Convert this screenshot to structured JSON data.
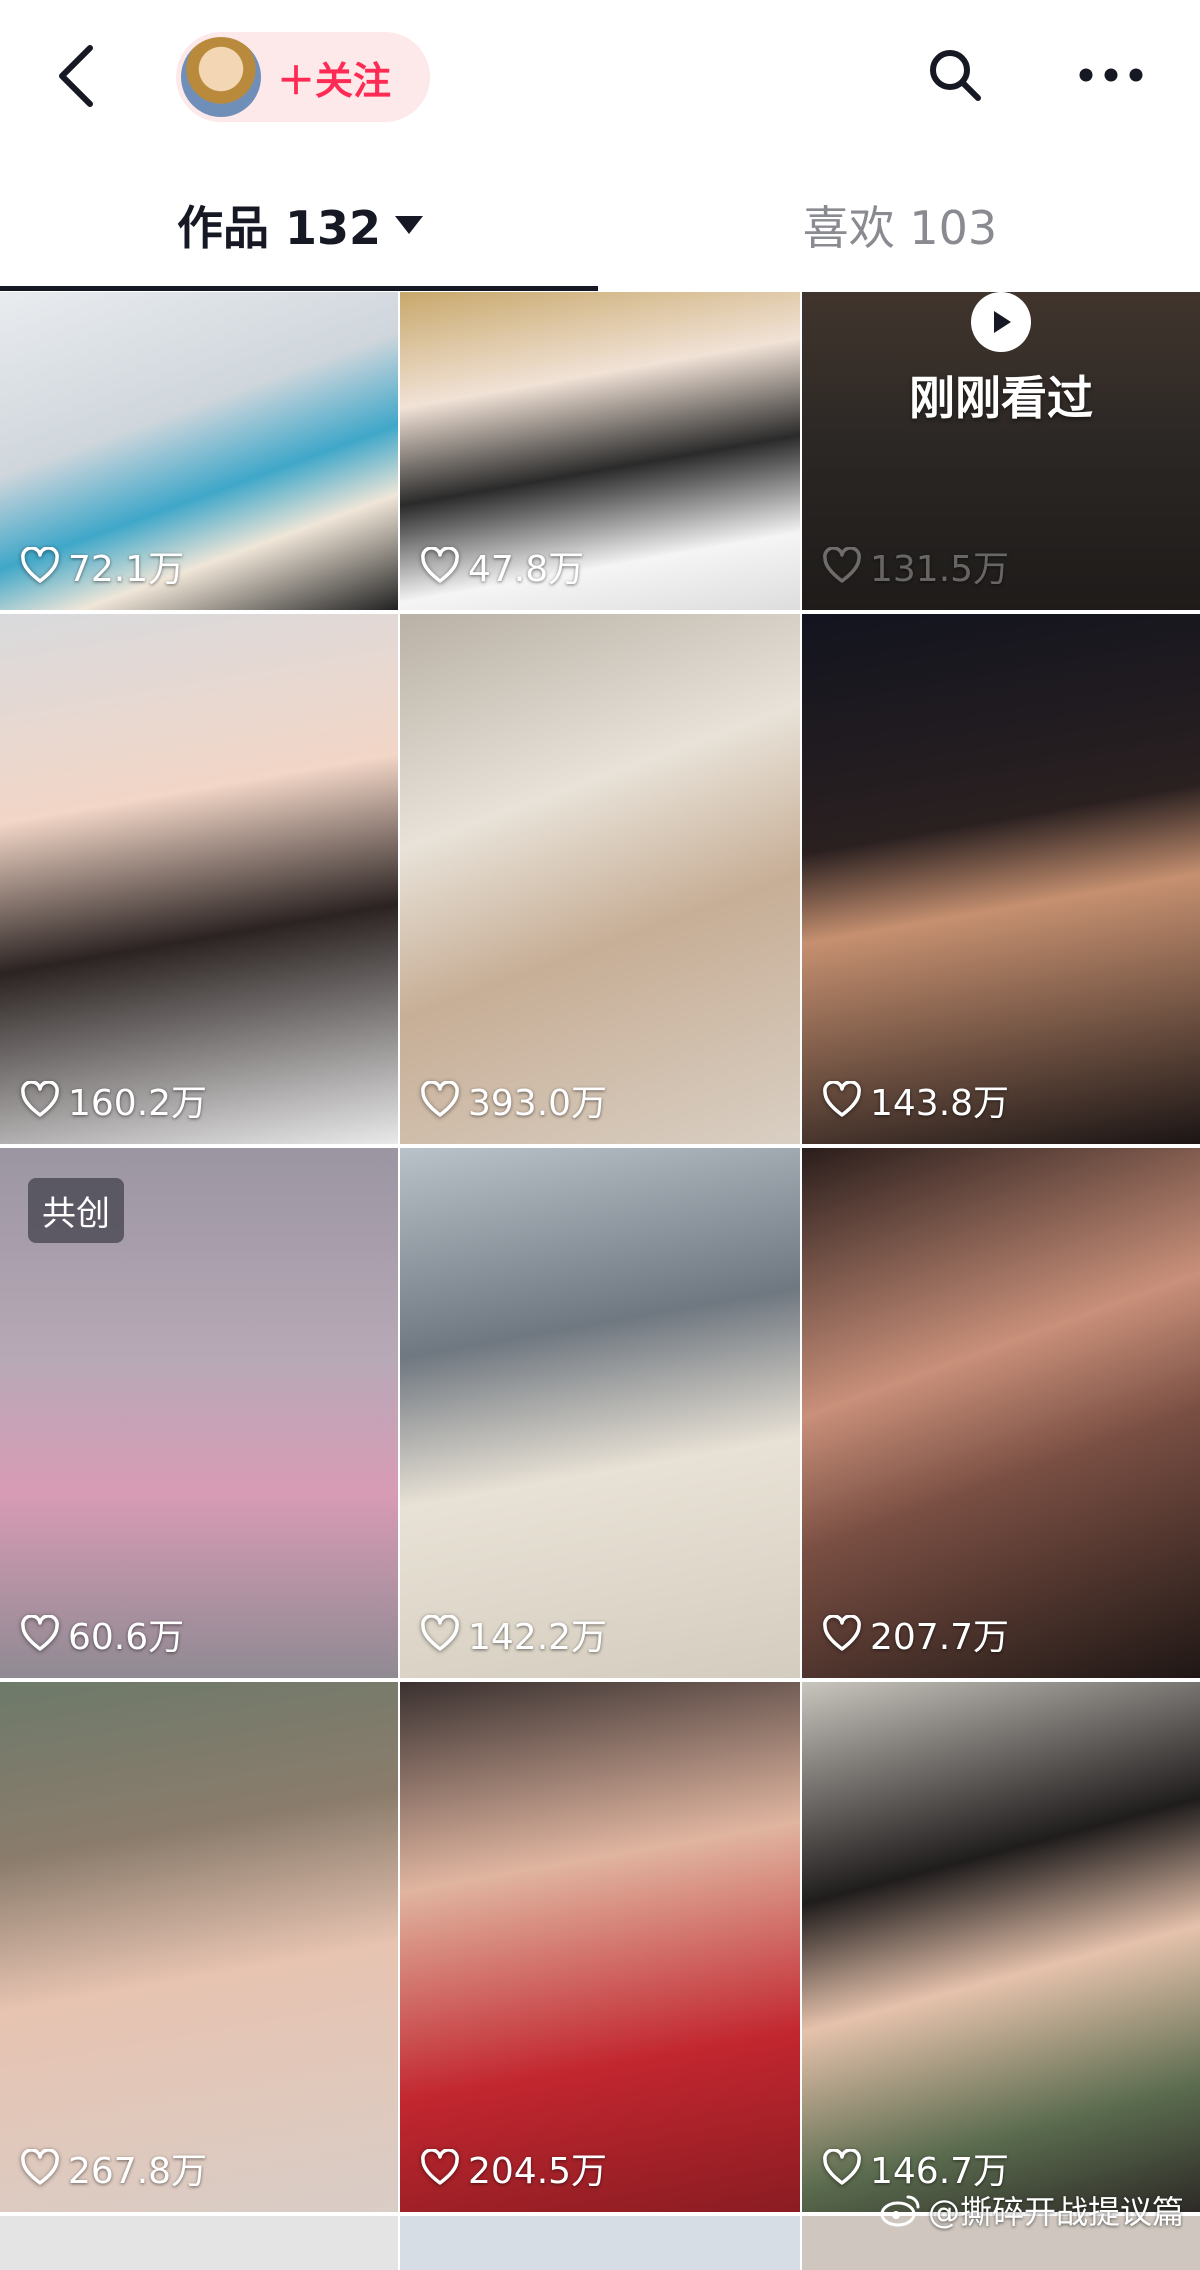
{
  "header": {
    "follow_label": "＋关注",
    "icons": [
      "back-arrow-icon",
      "search-icon",
      "more-icon"
    ]
  },
  "tabs": {
    "works_label": "作品 132",
    "likes_label": "喜欢 103"
  },
  "grid": {
    "items": [
      {
        "likes": "72.1万"
      },
      {
        "likes": "47.8万"
      },
      {
        "likes": "131.5万",
        "recent_label": "刚刚看过"
      },
      {
        "likes": "160.2万"
      },
      {
        "likes": "393.0万"
      },
      {
        "likes": "143.8万"
      },
      {
        "likes": "60.6万",
        "badge": "共创"
      },
      {
        "likes": "142.2万"
      },
      {
        "likes": "207.7万"
      },
      {
        "likes": "267.8万"
      },
      {
        "likes": "204.5万"
      },
      {
        "likes": "146.7万"
      }
    ]
  },
  "watermark": "@撕碎开战提议篇",
  "colors": {
    "accent": "#fe2c55",
    "follow_bg": "#fde8ea",
    "text": "#161823",
    "muted": "#8a8b91"
  }
}
